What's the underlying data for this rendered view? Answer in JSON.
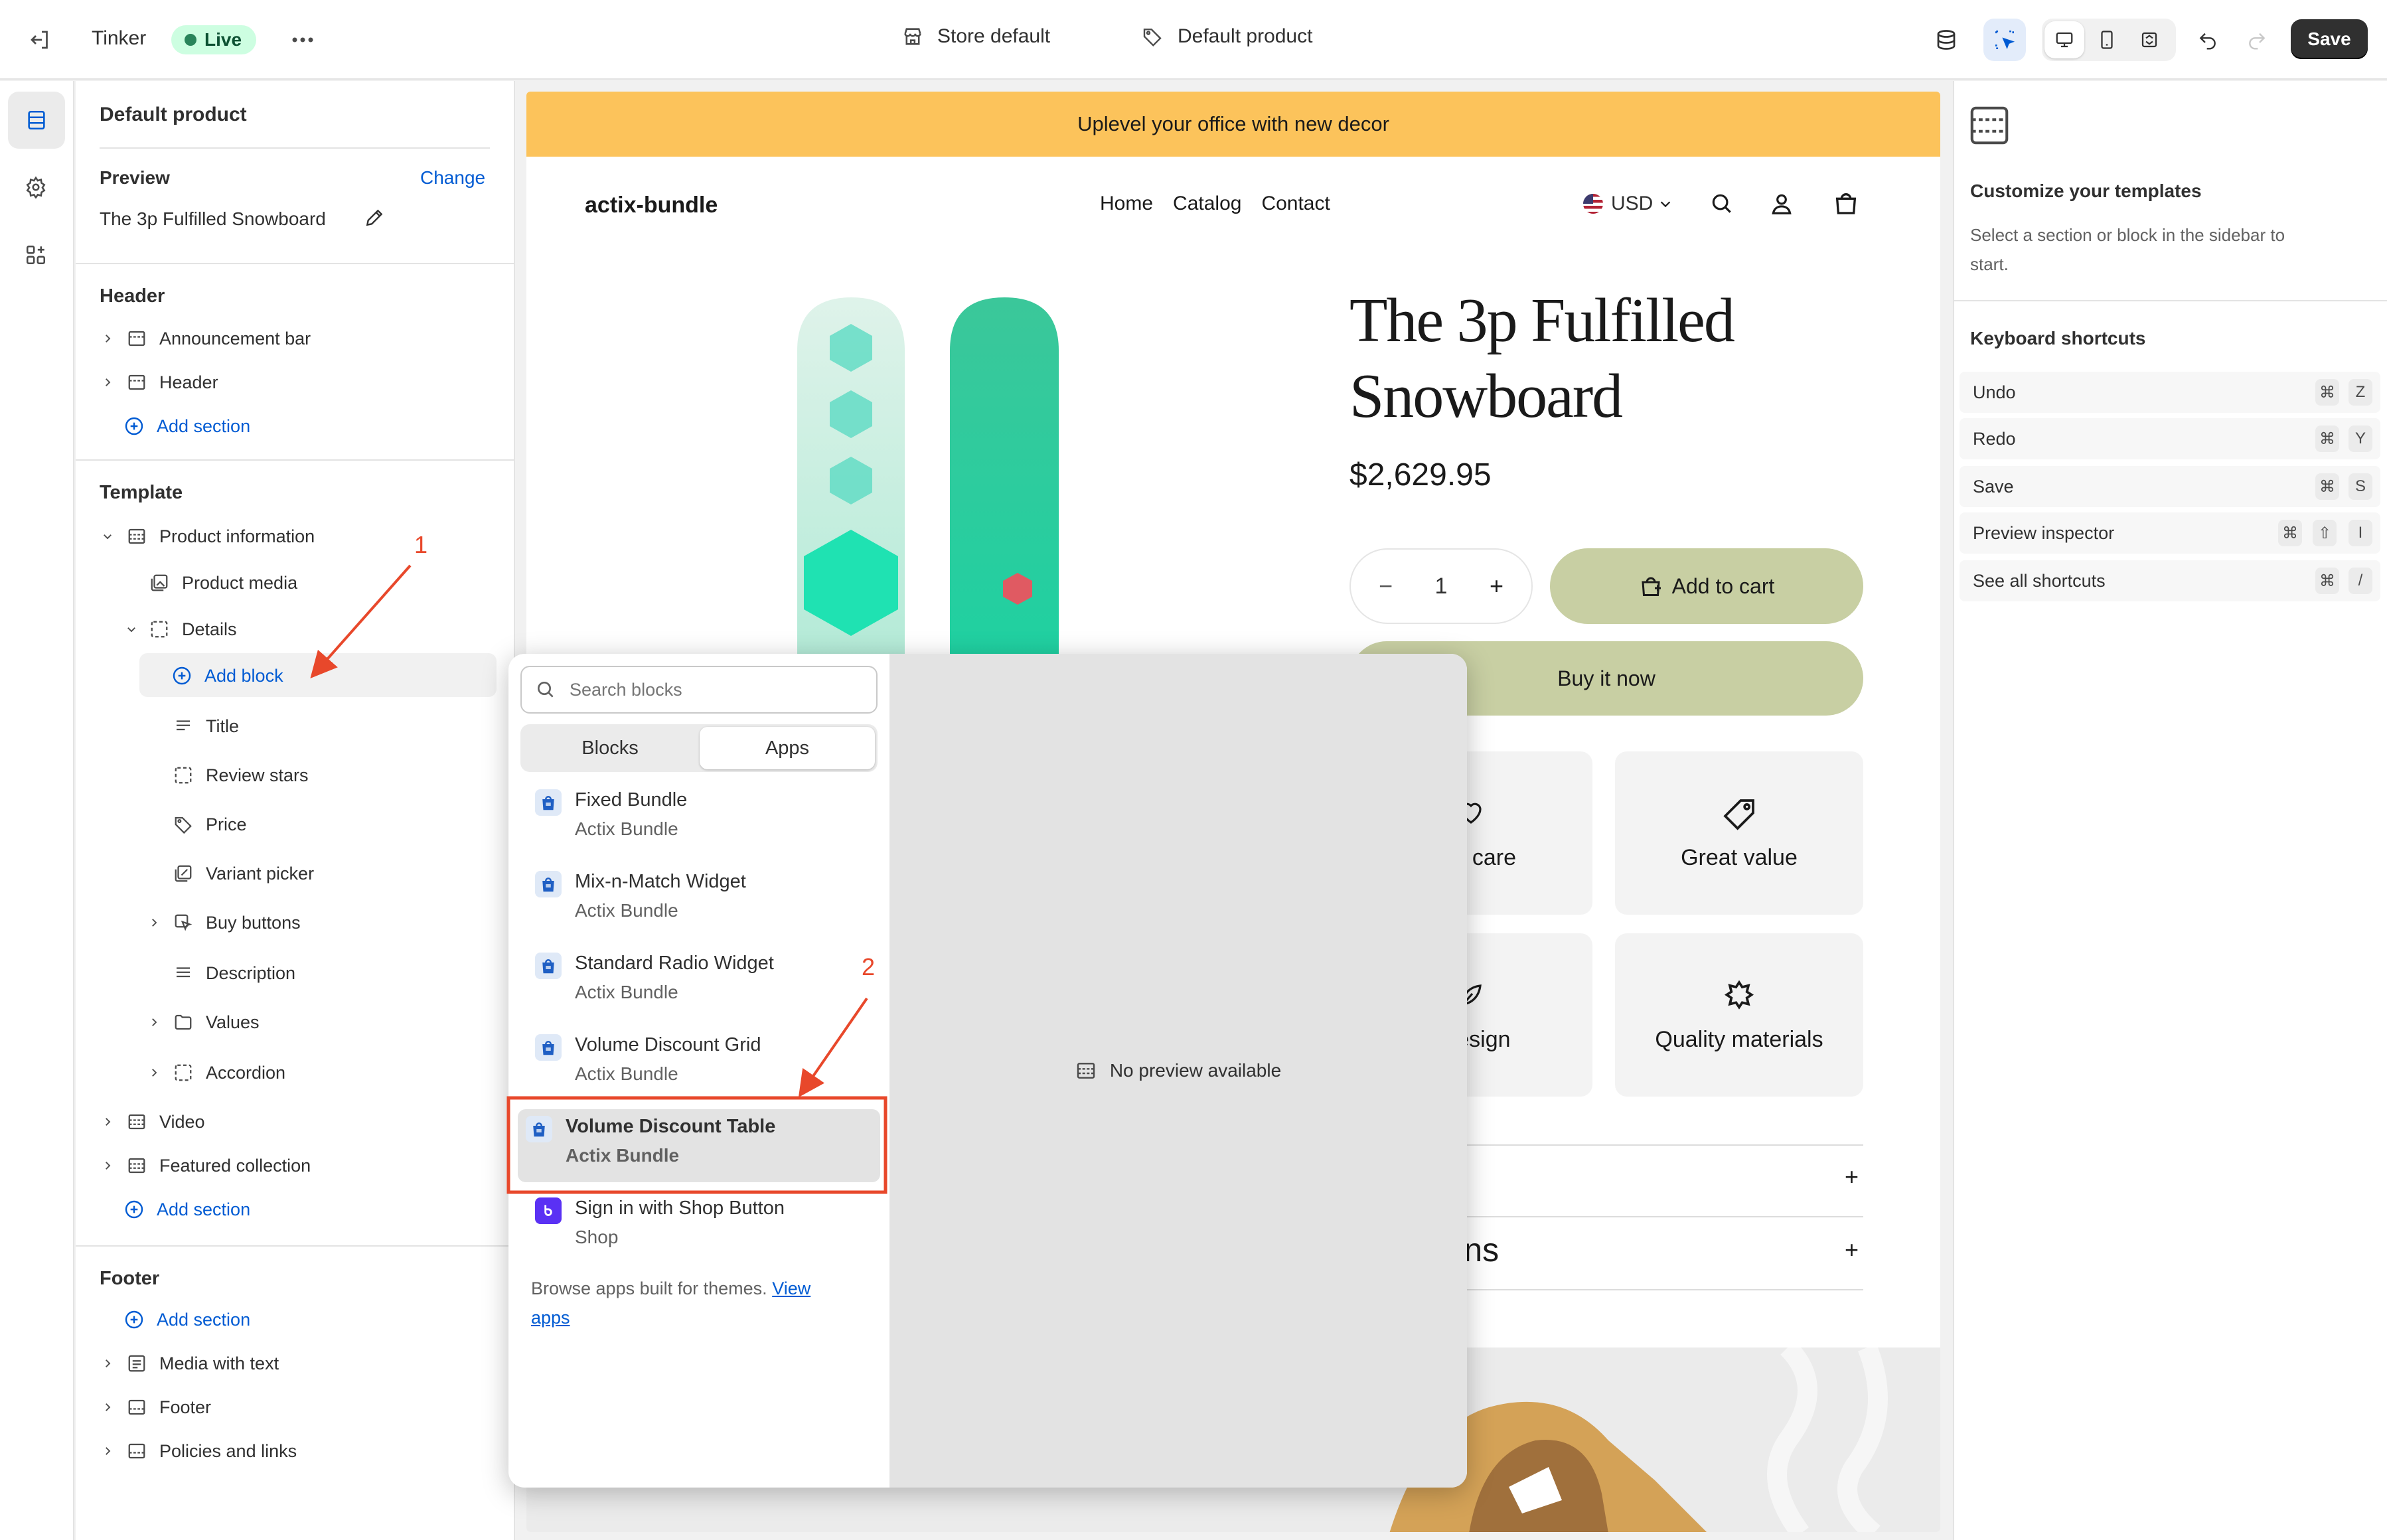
{
  "topbar": {
    "app_name": "Tinker",
    "status": "Live",
    "store_label": "Store default",
    "template_label": "Default product",
    "save_label": "Save"
  },
  "sidebar": {
    "title": "Default product",
    "preview_label": "Preview",
    "change_label": "Change",
    "preview_product": "The 3p Fulfilled Snowboard",
    "header_group": "Header",
    "header_items": [
      "Announcement bar",
      "Header"
    ],
    "add_section": "Add section",
    "template_group": "Template",
    "product_information": "Product information",
    "product_media": "Product media",
    "details": "Details",
    "add_block": "Add block",
    "detail_blocks": [
      "Title",
      "Review stars",
      "Price",
      "Variant picker",
      "Buy buttons",
      "Description",
      "Values",
      "Accordion"
    ],
    "template_more": [
      "Video",
      "Featured collection"
    ],
    "footer_group": "Footer",
    "footer_items": [
      "Media with text",
      "Footer",
      "Policies and links"
    ]
  },
  "annotations": {
    "one": "1",
    "two": "2"
  },
  "storefront": {
    "announcement": "Uplevel your office with new decor",
    "brand": "actix-bundle",
    "nav": [
      "Home",
      "Catalog",
      "Contact"
    ],
    "currency": "USD",
    "product_title_line1": "The 3p Fulfilled",
    "product_title_line2": "Snowboard",
    "price": "$2,629.95",
    "quantity": "1",
    "add_to_cart": "Add to cart",
    "buy_now": "Buy it now",
    "features": [
      "with care",
      "Great value",
      "t design",
      "Quality materials"
    ],
    "accordion_2": "ig & Returns"
  },
  "picker": {
    "search_placeholder": "Search blocks",
    "tabs": [
      "Blocks",
      "Apps"
    ],
    "apps": [
      {
        "name": "Fixed Bundle",
        "vendor": "Actix Bundle"
      },
      {
        "name": "Mix-n-Match Widget",
        "vendor": "Actix Bundle"
      },
      {
        "name": "Standard Radio Widget",
        "vendor": "Actix Bundle"
      },
      {
        "name": "Volume Discount Grid",
        "vendor": "Actix Bundle"
      },
      {
        "name": "Volume Discount Table",
        "vendor": "Actix Bundle"
      },
      {
        "name": "Sign in with Shop Button",
        "vendor": "Shop"
      }
    ],
    "browse_text": "Browse apps built for themes.",
    "view_link_1": "View",
    "view_link_2": "apps",
    "no_preview": "No preview available"
  },
  "rpanel": {
    "title": "Customize your templates",
    "desc_line1": "Select a section or block in the sidebar to",
    "desc_line2": "start.",
    "shortcuts_title": "Keyboard shortcuts",
    "shortcuts": [
      {
        "label": "Undo",
        "keys": [
          "⌘",
          "Z"
        ]
      },
      {
        "label": "Redo",
        "keys": [
          "⌘",
          "Y"
        ]
      },
      {
        "label": "Save",
        "keys": [
          "⌘",
          "S"
        ]
      },
      {
        "label": "Preview inspector",
        "keys": [
          "⌘",
          "⇧",
          "I"
        ]
      },
      {
        "label": "See all shortcuts",
        "keys": [
          "⌘",
          "/"
        ]
      }
    ]
  },
  "colors": {
    "accent_blue": "#005bd3",
    "announcement_bg": "#fcc35b",
    "button_green": "#c8cfa3",
    "annotation_red": "#e8482b"
  }
}
